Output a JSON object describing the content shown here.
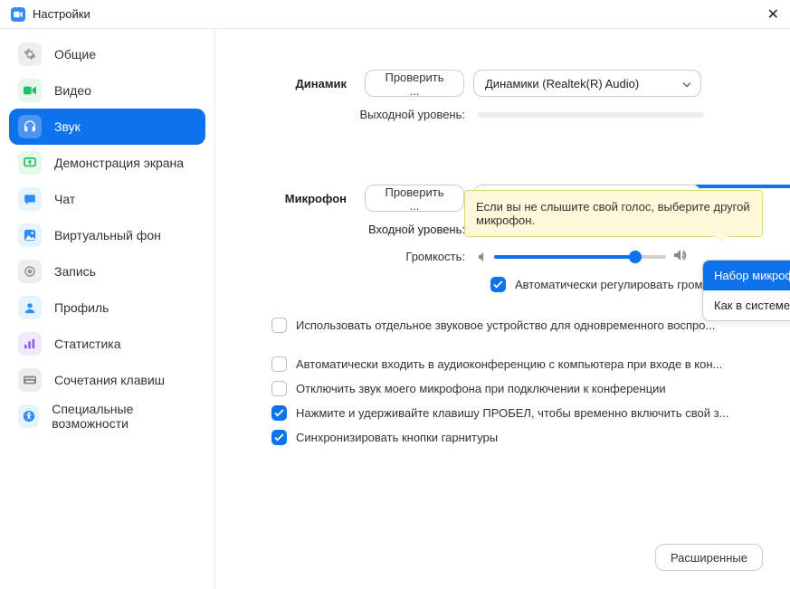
{
  "window": {
    "title": "Настройки"
  },
  "sidebar": {
    "items": [
      {
        "label": "Общие"
      },
      {
        "label": "Видео"
      },
      {
        "label": "Звук"
      },
      {
        "label": "Демонстрация экрана"
      },
      {
        "label": "Чат"
      },
      {
        "label": "Виртуальный фон"
      },
      {
        "label": "Запись"
      },
      {
        "label": "Профиль"
      },
      {
        "label": "Статистика"
      },
      {
        "label": "Сочетания клавиш"
      },
      {
        "label": "Специальные возможности"
      }
    ]
  },
  "speaker": {
    "label": "Динамик",
    "test_button": "Проверить ...",
    "device": "Динамики (Realtek(R) Audio)",
    "output_level_label": "Выходной уровень:"
  },
  "tooltip": "Если вы не слышите свой голос, выберите другой микрофон.",
  "microphone": {
    "label": "Микрофон",
    "test_button": "Проверить ...",
    "device": "Набор микрофонов (Realtek(R) ...",
    "input_level_label": "Входной уровень:",
    "volume_label": "Громкость:",
    "volume_percent": 82,
    "dropdown_options": [
      "Набор микрофонов (Realtek(R) Audio)",
      "Как в системе"
    ],
    "auto_adjust": {
      "checked": true,
      "label": "Автоматически регулировать гром..."
    }
  },
  "options": [
    {
      "checked": false,
      "label": "Использовать отдельное звуковое устройство для одновременного воспро..."
    },
    {
      "checked": false,
      "label": "Автоматически входить в аудиоконференцию с компьютера при входе в кон..."
    },
    {
      "checked": false,
      "label": "Отключить звук моего микрофона при подключении к конференции"
    },
    {
      "checked": true,
      "label": "Нажмите и удерживайте клавишу ПРОБЕЛ, чтобы временно включить свой з..."
    },
    {
      "checked": true,
      "label": "Синхронизировать кнопки гарнитуры"
    }
  ],
  "advanced_button": "Расширенные"
}
